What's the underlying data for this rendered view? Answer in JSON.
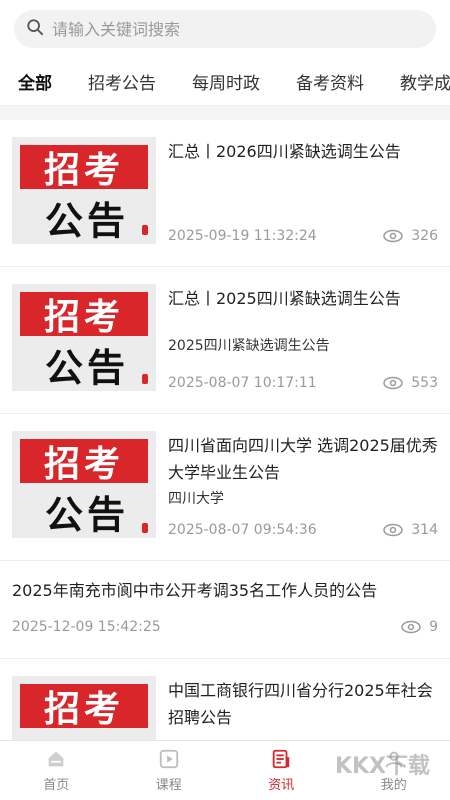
{
  "search": {
    "placeholder": "请输入关键词搜索",
    "icon": "search-icon"
  },
  "tabs": [
    "全部",
    "招考公告",
    "每周时政",
    "备考资料",
    "教学成"
  ],
  "active_tab": "全部",
  "thumb": {
    "top_text": "招考",
    "bottom_text": "公告"
  },
  "items": [
    {
      "title": "汇总丨2026四川紧缺选调生公告",
      "sub": "",
      "date": "2025-09-19 11:32:24",
      "views": "326",
      "has_image": true
    },
    {
      "title": "汇总丨2025四川紧缺选调生公告",
      "sub": "2025四川紧缺选调生公告",
      "date": "2025-08-07 10:17:11",
      "views": "553",
      "has_image": true
    },
    {
      "title": "四川省面向四川大学 选调2025届优秀大学毕业生公告",
      "sub": "四川大学",
      "date": "2025-08-07 09:54:36",
      "views": "314",
      "has_image": true
    },
    {
      "title": "2025年南充市阆中市公开考调35名工作人员的公告",
      "sub": "",
      "date": "2025-12-09 15:42:25",
      "views": "9",
      "has_image": false
    },
    {
      "title": "中国工商银行四川省分行2025年社会招聘公告",
      "sub": "",
      "date": "",
      "views": "",
      "has_image": true
    }
  ],
  "bottom_nav": [
    {
      "label": "首页",
      "icon": "home-icon"
    },
    {
      "label": "课程",
      "icon": "play-icon"
    },
    {
      "label": "资讯",
      "icon": "news-icon",
      "active": true
    },
    {
      "label": "我的",
      "icon": "user-icon"
    }
  ],
  "watermark": "KKX下载",
  "colors": {
    "accent": "#d8262b",
    "muted": "#9a9a9a"
  }
}
